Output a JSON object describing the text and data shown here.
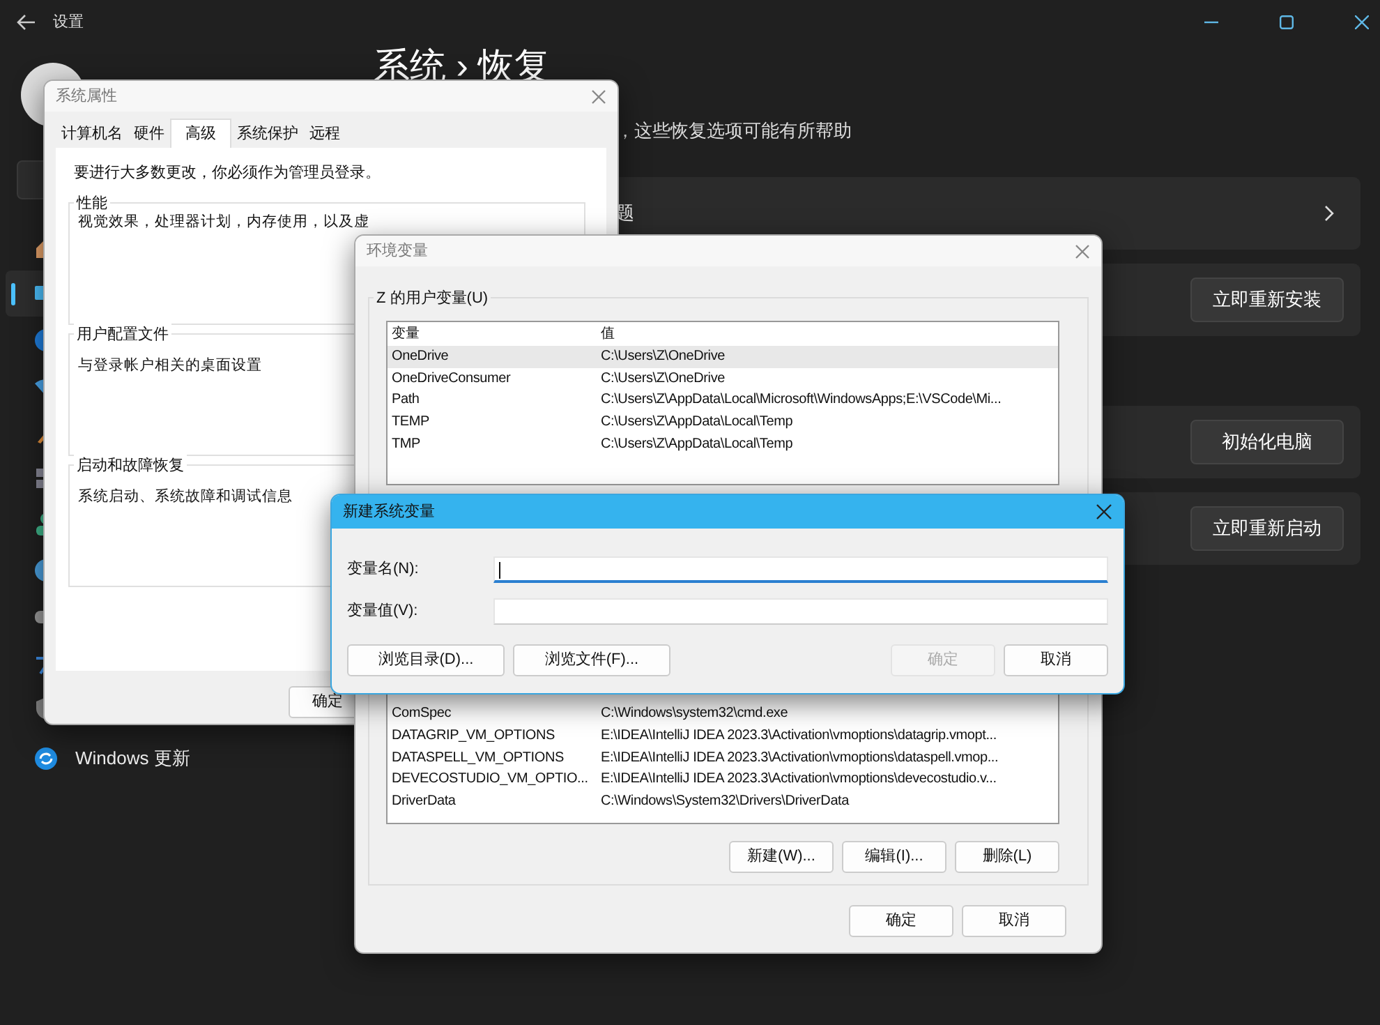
{
  "settings": {
    "title": "设置",
    "breadcrumb": {
      "parent": "系统",
      "separator": "›",
      "current": "恢复"
    },
    "nav_items": [
      {
        "selected": false
      },
      {
        "selected": true
      },
      {
        "selected": false
      },
      {
        "selected": false
      },
      {
        "selected": false
      },
      {
        "selected": false
      },
      {
        "selected": false
      },
      {
        "selected": false
      },
      {
        "selected": false
      },
      {
        "selected": false
      },
      {
        "selected": false
      },
      {
        "label": "Windows 更新",
        "selected": false
      }
    ],
    "subtitle": "，这些恢复选项可能有所帮助",
    "cards": [
      {
        "kind": "link",
        "title": "题"
      },
      {
        "kind": "action",
        "button": "立即重新安装"
      },
      {
        "kind": "action",
        "button": "初始化电脑"
      },
      {
        "kind": "action",
        "button": "立即重新启动"
      }
    ]
  },
  "system_properties": {
    "title": "系统属性",
    "tabs": [
      {
        "label": "计算机名",
        "selected": false
      },
      {
        "label": "硬件",
        "selected": false
      },
      {
        "label": "高级",
        "selected": true
      },
      {
        "label": "系统保护",
        "selected": false
      },
      {
        "label": "远程",
        "selected": false
      }
    ],
    "notice": "要进行大多数更改，你必须作为管理员登录。",
    "groups": [
      {
        "title": "性能",
        "text": "视觉效果，处理器计划，内存使用，以及虚"
      },
      {
        "title": "用户配置文件",
        "text": "与登录帐户相关的桌面设置"
      },
      {
        "title": "启动和故障恢复",
        "text": "系统启动、系统故障和调试信息"
      }
    ],
    "buttons": [
      "确定"
    ]
  },
  "environment_variables": {
    "title": "环境变量",
    "user_group": {
      "title": "Z 的用户变量(U)",
      "columns": [
        "变量",
        "值"
      ],
      "rows": [
        {
          "name": "OneDrive",
          "value": "C:\\Users\\Z\\OneDrive",
          "selected": true
        },
        {
          "name": "OneDriveConsumer",
          "value": "C:\\Users\\Z\\OneDrive",
          "selected": false
        },
        {
          "name": "Path",
          "value": "C:\\Users\\Z\\AppData\\Local\\Microsoft\\WindowsApps;E:\\VSCode\\Mi...",
          "selected": false
        },
        {
          "name": "TEMP",
          "value": "C:\\Users\\Z\\AppData\\Local\\Temp",
          "selected": false
        },
        {
          "name": "TMP",
          "value": "C:\\Users\\Z\\AppData\\Local\\Temp",
          "selected": false
        }
      ]
    },
    "system_group": {
      "rows": [
        {
          "name": "ComSpec",
          "value": "C:\\Windows\\system32\\cmd.exe",
          "selected": false
        },
        {
          "name": "DATAGRIP_VM_OPTIONS",
          "value": "E:\\IDEA\\IntelliJ IDEA 2023.3\\Activation\\vmoptions\\datagrip.vmopt...",
          "selected": false
        },
        {
          "name": "DATASPELL_VM_OPTIONS",
          "value": "E:\\IDEA\\IntelliJ IDEA 2023.3\\Activation\\vmoptions\\dataspell.vmop...",
          "selected": false
        },
        {
          "name": "DEVECOSTUDIO_VM_OPTIO...",
          "value": "E:\\IDEA\\IntelliJ IDEA 2023.3\\Activation\\vmoptions\\devecostudio.v...",
          "selected": false
        },
        {
          "name": "DriverData",
          "value": "C:\\Windows\\System32\\Drivers\\DriverData",
          "selected": false
        }
      ]
    },
    "group_buttons": [
      "新建(W)...",
      "编辑(I)...",
      "删除(L)"
    ],
    "buttons": [
      "确定",
      "取消"
    ]
  },
  "new_variable_dialog": {
    "title": "新建系统变量",
    "fields": [
      {
        "label": "变量名(N):",
        "focused": true
      },
      {
        "label": "变量值(V):",
        "focused": false
      }
    ],
    "buttons": [
      {
        "label": "浏览目录(D)...",
        "disabled": false
      },
      {
        "label": "浏览文件(F)...",
        "disabled": false
      },
      {
        "label": "确定",
        "disabled": true
      },
      {
        "label": "取消",
        "disabled": false
      }
    ]
  }
}
